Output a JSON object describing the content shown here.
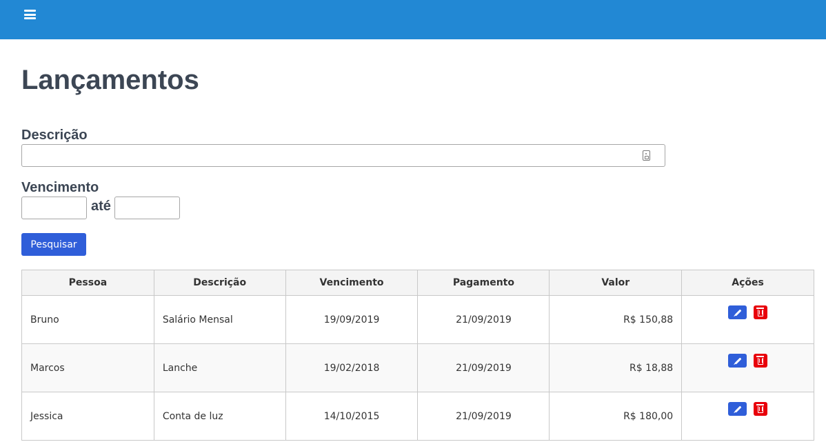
{
  "header": {
    "menu_icon": "hamburger-menu-icon",
    "color": "#2288d4"
  },
  "page": {
    "title": "Lançamentos"
  },
  "filters": {
    "descricao_label": "Descrição",
    "descricao_value": "",
    "vencimento_label": "Vencimento",
    "vencimento_de": "",
    "ate_label": "até",
    "vencimento_ate": "",
    "search_button": "Pesquisar"
  },
  "table": {
    "columns": [
      "Pessoa",
      "Descrição",
      "Vencimento",
      "Pagamento",
      "Valor",
      "Ações"
    ],
    "rows": [
      {
        "pessoa": "Bruno",
        "descricao": "Salário Mensal",
        "vencimento": "19/09/2019",
        "pagamento": "21/09/2019",
        "valor": "R$ 150,88"
      },
      {
        "pessoa": "Marcos",
        "descricao": "Lanche",
        "vencimento": "19/02/2018",
        "pagamento": "21/09/2019",
        "valor": "R$ 18,88"
      },
      {
        "pessoa": "Jessica",
        "descricao": "Conta de luz",
        "vencimento": "14/10/2015",
        "pagamento": "21/09/2019",
        "valor": "R$ 180,00"
      }
    ]
  },
  "colors": {
    "primary": "#2f5ed9",
    "danger": "#e8000b",
    "value_text": "#d0021b"
  }
}
